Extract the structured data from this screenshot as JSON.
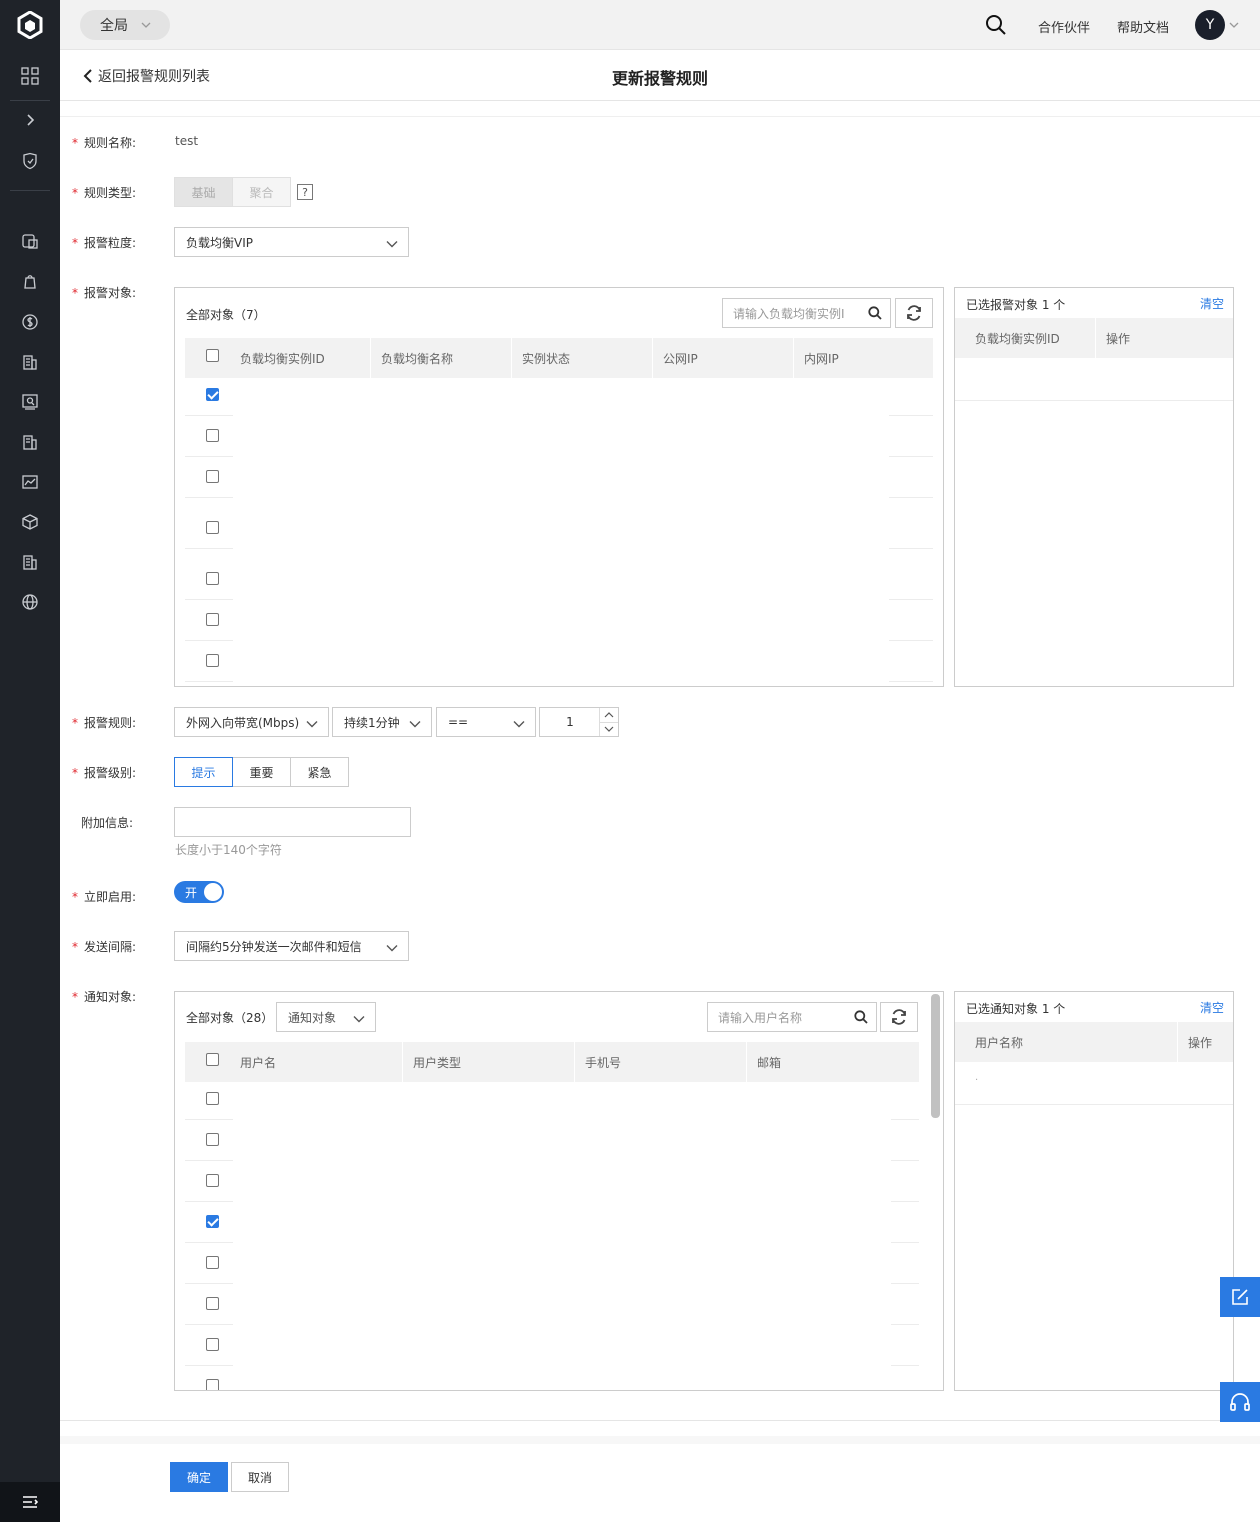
{
  "topbar": {
    "scope": "全局",
    "partner_link": "合作伙伴",
    "docs_link": "帮助文档",
    "avatar_initial": "Y"
  },
  "titlebar": {
    "back_label": "返回报警规则列表",
    "title": "更新报警规则"
  },
  "form": {
    "name": {
      "label": "规则名称:",
      "value": "test"
    },
    "type": {
      "label": "规则类型:",
      "options": [
        "基础",
        "聚合"
      ],
      "help": "?"
    },
    "granularity": {
      "label": "报警粒度:",
      "value": "负载均衡VIP"
    },
    "targets": {
      "label": "报警对象:",
      "all_title": "全部对象（7）",
      "search_placeholder": "请输入负载均衡实例I",
      "columns": [
        "负载均衡实例ID",
        "负载均衡名称",
        "实例状态",
        "公网IP",
        "内网IP"
      ],
      "rows": [
        {
          "checked": true
        },
        {
          "checked": false
        },
        {
          "checked": false
        },
        {
          "checked": false
        },
        {
          "checked": false
        },
        {
          "checked": false
        },
        {
          "checked": false
        }
      ],
      "selected_title": "已选报警对象 1 个",
      "clear": "清空",
      "selected_columns": [
        "负载均衡实例ID",
        "操作"
      ]
    },
    "rule": {
      "label": "报警规则:",
      "metric": "外网入向带宽(Mbps)",
      "duration": "持续1分钟",
      "operator": "==",
      "threshold": "1"
    },
    "level": {
      "label": "报警级别:",
      "options": [
        "提示",
        "重要",
        "紧急"
      ],
      "selected": "提示"
    },
    "extra": {
      "label": "附加信息:",
      "value": "",
      "hint": "长度小于140个字符"
    },
    "enable": {
      "label": "立即启用:",
      "toggle_text": "开",
      "on": true
    },
    "interval": {
      "label": "发送间隔:",
      "value": "间隔约5分钟发送一次邮件和短信"
    },
    "notify": {
      "label": "通知对象:",
      "all_title": "全部对象（28）",
      "filter": "通知对象",
      "search_placeholder": "请输入用户名称",
      "columns": [
        "用户名",
        "用户类型",
        "手机号",
        "邮箱"
      ],
      "rows": [
        {
          "checked": false
        },
        {
          "checked": false
        },
        {
          "checked": false
        },
        {
          "checked": true
        },
        {
          "checked": false
        },
        {
          "checked": false
        },
        {
          "checked": false
        },
        {
          "checked": false
        }
      ],
      "selected_title": "已选通知对象 1 个",
      "clear": "清空",
      "selected_columns": [
        "用户名称",
        "操作"
      ],
      "selected_placeholder": "."
    }
  },
  "actions": {
    "confirm": "确定",
    "cancel": "取消"
  },
  "colors": {
    "accent": "#2a7ae2",
    "sidebar": "#1f2329",
    "required": "#e0282f"
  }
}
